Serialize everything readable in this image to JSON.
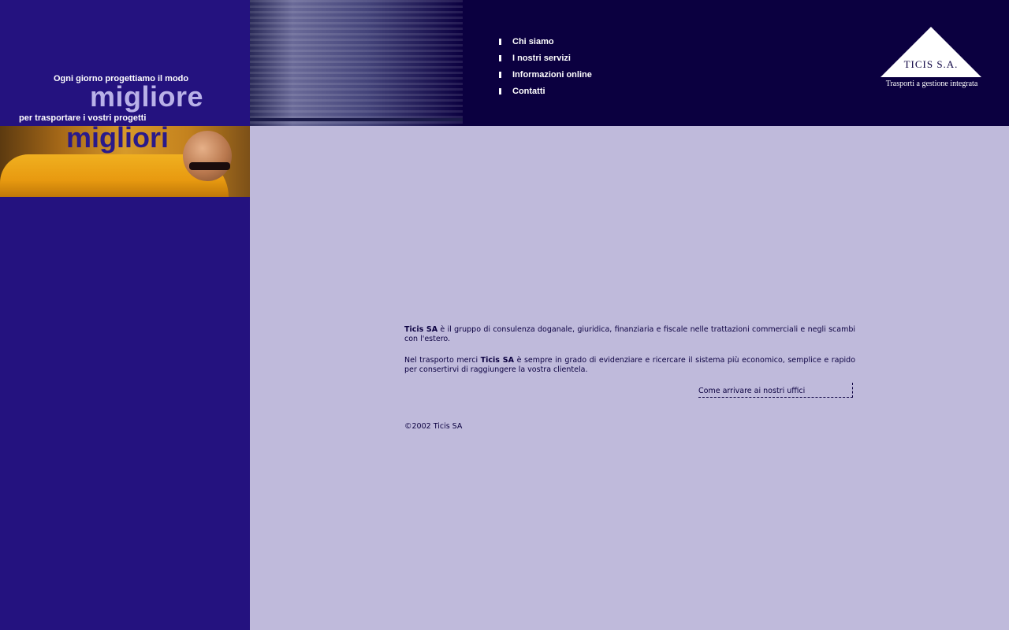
{
  "slogan": {
    "line1": "Ogni giorno progettiamo il modo",
    "big1": "migliore",
    "line2": "per trasportare i vostri progetti",
    "big2": "migliori"
  },
  "nav": {
    "items": [
      {
        "label": "Chi siamo"
      },
      {
        "label": "I nostri servizi"
      },
      {
        "label": "Informazioni online"
      },
      {
        "label": "Contatti"
      }
    ]
  },
  "logo": {
    "name": "TICIS S.A.",
    "tagline": "Trasporti a gestione integrata"
  },
  "content": {
    "p1_company": "Ticis SA",
    "p1_text": " è il gruppo di consulenza doganale, giuridica, finanziaria e fiscale nelle trattazioni commerciali e negli scambi con l'estero.",
    "p2_prefix": "Nel trasporto merci ",
    "p2_company": "Ticis SA",
    "p2_text": " è sempre in grado di evidenziare e ricercare il sistema più economico, semplice e rapido per consertirvi di raggiungere la vostra clientela.",
    "directions_link": "Come arrivare ai nostri uffici",
    "copyright": "©2002 Ticis SA"
  },
  "colors": {
    "sidebar": "#24127f",
    "header": "#0b0040",
    "page_bg": "#bfbadb"
  }
}
